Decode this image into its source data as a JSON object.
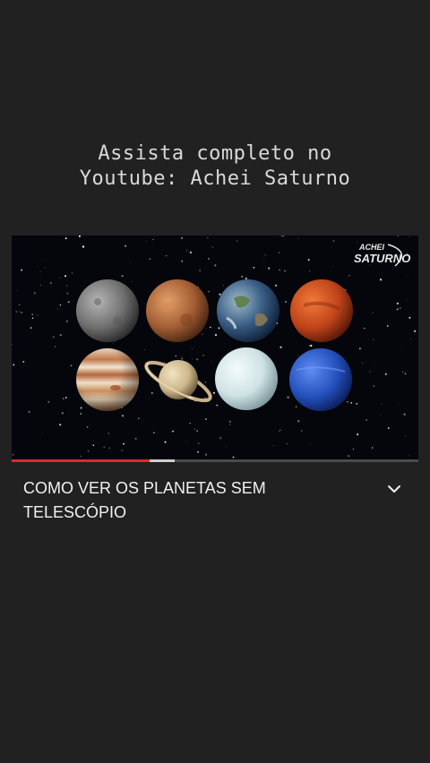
{
  "overlay_caption": {
    "line1": "Assista completo no",
    "line2": "Youtube: Achei Saturno"
  },
  "video": {
    "watermark_top": "ACHEI",
    "watermark_bottom": "SATURNO",
    "planets": [
      {
        "name": "mercury",
        "color": "#7b7b7b"
      },
      {
        "name": "venus",
        "color": "#b0673a"
      },
      {
        "name": "earth",
        "color": "#3c5e8f"
      },
      {
        "name": "mars",
        "color": "#c84a1e"
      },
      {
        "name": "jupiter",
        "color": "#c89a70"
      },
      {
        "name": "saturn",
        "color": "#d7c39a"
      },
      {
        "name": "uranus",
        "color": "#d8e8ea"
      },
      {
        "name": "neptune",
        "color": "#2957c6"
      }
    ]
  },
  "progress": {
    "played_fraction": 0.34,
    "buffered_fraction": 0.4,
    "played_color": "#e1262b"
  },
  "title": "COMO VER OS PLANETAS SEM TELESCÓPIO",
  "expand_icon": "chevron-down-icon"
}
